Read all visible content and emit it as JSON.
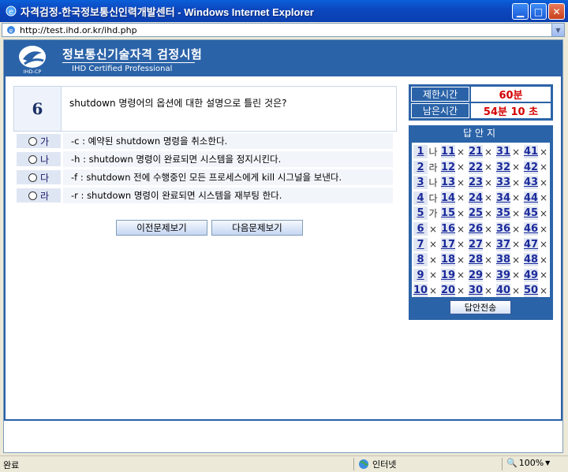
{
  "window": {
    "title": "자격검정-한국정보통신인력개발센터 - Windows Internet Explorer",
    "url": "http://test.ihd.or.kr/ihd.php"
  },
  "header": {
    "title": "정보통신기술자격 검정시험",
    "subtitle": "IHD Certified Professional",
    "logo_text": "IHD-CP"
  },
  "question": {
    "number": "6",
    "text": "shutdown 명령어의 옵션에 대한 설명으로 틀린 것은?",
    "options": [
      {
        "label": "가",
        "text": "-c : 예약된 shutdown 명령을 취소한다."
      },
      {
        "label": "나",
        "text": "-h : shutdown 명령이 완료되면 시스템을 정지시킨다."
      },
      {
        "label": "다",
        "text": "-f : shutdown 전에 수행중인 모든 프로세스에게 kill 시그널을 보낸다."
      },
      {
        "label": "라",
        "text": "-r : shutdown 명령이 완료되면 시스템을 재부팅 한다."
      }
    ]
  },
  "nav": {
    "prev": "이전문제보기",
    "next": "다음문제보기"
  },
  "timer": {
    "limit_label": "제한시간",
    "limit_value": "60분",
    "remain_label": "남은시간",
    "remain_value": "54분 10 초"
  },
  "answer_sheet": {
    "title": "답안지",
    "submit": "답안전송",
    "columns": [
      [
        [
          "1",
          "나"
        ],
        [
          "2",
          "라"
        ],
        [
          "3",
          "나"
        ],
        [
          "4",
          "다"
        ],
        [
          "5",
          "가"
        ],
        [
          "6",
          "×"
        ],
        [
          "7",
          "×"
        ],
        [
          "8",
          "×"
        ],
        [
          "9",
          "×"
        ],
        [
          "10",
          "×"
        ]
      ],
      [
        [
          "11",
          "×"
        ],
        [
          "12",
          "×"
        ],
        [
          "13",
          "×"
        ],
        [
          "14",
          "×"
        ],
        [
          "15",
          "×"
        ],
        [
          "16",
          "×"
        ],
        [
          "17",
          "×"
        ],
        [
          "18",
          "×"
        ],
        [
          "19",
          "×"
        ],
        [
          "20",
          "×"
        ]
      ],
      [
        [
          "21",
          "×"
        ],
        [
          "22",
          "×"
        ],
        [
          "23",
          "×"
        ],
        [
          "24",
          "×"
        ],
        [
          "25",
          "×"
        ],
        [
          "26",
          "×"
        ],
        [
          "27",
          "×"
        ],
        [
          "28",
          "×"
        ],
        [
          "29",
          "×"
        ],
        [
          "30",
          "×"
        ]
      ],
      [
        [
          "31",
          "×"
        ],
        [
          "32",
          "×"
        ],
        [
          "33",
          "×"
        ],
        [
          "34",
          "×"
        ],
        [
          "35",
          "×"
        ],
        [
          "36",
          "×"
        ],
        [
          "37",
          "×"
        ],
        [
          "38",
          "×"
        ],
        [
          "39",
          "×"
        ],
        [
          "40",
          "×"
        ]
      ],
      [
        [
          "41",
          "×"
        ],
        [
          "42",
          "×"
        ],
        [
          "43",
          "×"
        ],
        [
          "44",
          "×"
        ],
        [
          "45",
          "×"
        ],
        [
          "46",
          "×"
        ],
        [
          "47",
          "×"
        ],
        [
          "48",
          "×"
        ],
        [
          "49",
          "×"
        ],
        [
          "50",
          "×"
        ]
      ]
    ]
  },
  "status": {
    "left": "완료",
    "zone": "인터넷",
    "zoom": "100%"
  },
  "colors": {
    "header_blue": "#2b63a8",
    "timer_red": "#d40000"
  }
}
